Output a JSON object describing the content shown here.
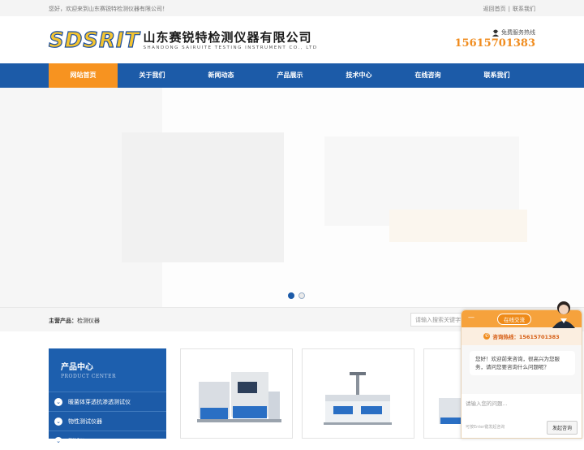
{
  "topbar": {
    "welcome": "您好，欢迎来到山东赛锐特检测仪器有限公司！",
    "links": [
      "返回首页",
      "联系我们"
    ]
  },
  "header": {
    "logo_mark": "SDSRIT",
    "logo_cn": "山东赛锐特检测仪器有限公司",
    "logo_en": "SHANDONG SAIRUITE TESTING INSTRUMENT CO., LTD",
    "hotline_label": "免费服务热线",
    "hotline_number": "15615701383",
    "hotline_icon": "service-headset-icon"
  },
  "nav": {
    "items": [
      "网站首页",
      "关于我们",
      "新闻动态",
      "产品展示",
      "技术中心",
      "在线咨询",
      "联系我们"
    ],
    "active_index": 0
  },
  "banner": {
    "slide_count": 2,
    "active_slide": 1
  },
  "crumbbar": {
    "label": "主营产品：",
    "value": "检测仪器",
    "search_placeholder": "请输入搜索关键字"
  },
  "sidebar": {
    "title": "产品中心",
    "subtitle": "PRODUCT CENTER",
    "items": [
      "暖菌体芽透抗渗透测试仪",
      "物性测试仪器",
      "测试仪"
    ]
  },
  "products": [
    {
      "image": "dissolution-tester-image"
    },
    {
      "image": "lab-instrument-image"
    },
    {
      "image": "tester-image"
    }
  ],
  "chat": {
    "minimize": "—",
    "tab": "在线交流",
    "hotline": "咨询热线：15615701383",
    "greeting": "您好！欢迎前来咨询，很高兴为您服务，请问您要咨询什么问题呢？",
    "input_placeholder": "请输入您的问题...",
    "tip": "可按Enter键发起咨询",
    "send": "发起咨询"
  },
  "colors": {
    "primary": "#1c5ba8",
    "accent": "#f79320",
    "chat": "#f6a23c"
  }
}
